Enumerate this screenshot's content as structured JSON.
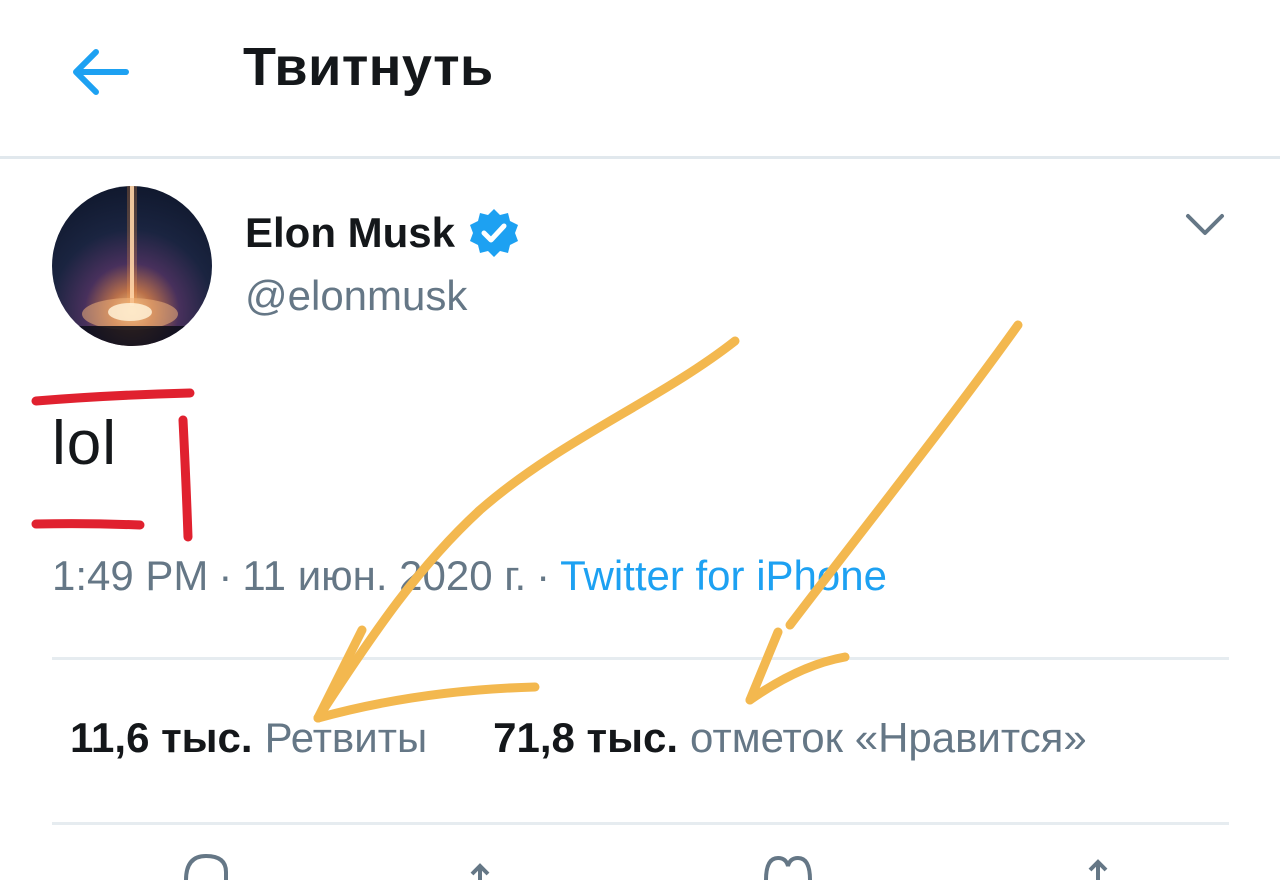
{
  "header": {
    "back_icon": "arrow-left-icon",
    "title": "Твитнуть"
  },
  "tweet": {
    "author": {
      "display_name": "Elon Musk",
      "handle": "@elonmusk",
      "verified": true
    },
    "text": "lol",
    "time": "1:49 PM",
    "date": "11 июн. 2020 г.",
    "separator": "·",
    "source": "Twitter for iPhone",
    "retweets": {
      "count": "11,6 тыс.",
      "label": "Ретвиты"
    },
    "likes": {
      "count": "71,8 тыс.",
      "label": "отметок «Нравится»"
    }
  },
  "colors": {
    "accent": "#1da1f2",
    "text": "#14171a",
    "secondary": "#657786",
    "divider": "#e6ecf0",
    "annotation_red": "#e0212f",
    "annotation_yellow": "#f3b84f"
  },
  "icons": [
    "arrow-left-icon",
    "verified-badge-icon",
    "chevron-down-icon",
    "reply-icon",
    "retweet-icon",
    "like-icon",
    "share-icon"
  ]
}
